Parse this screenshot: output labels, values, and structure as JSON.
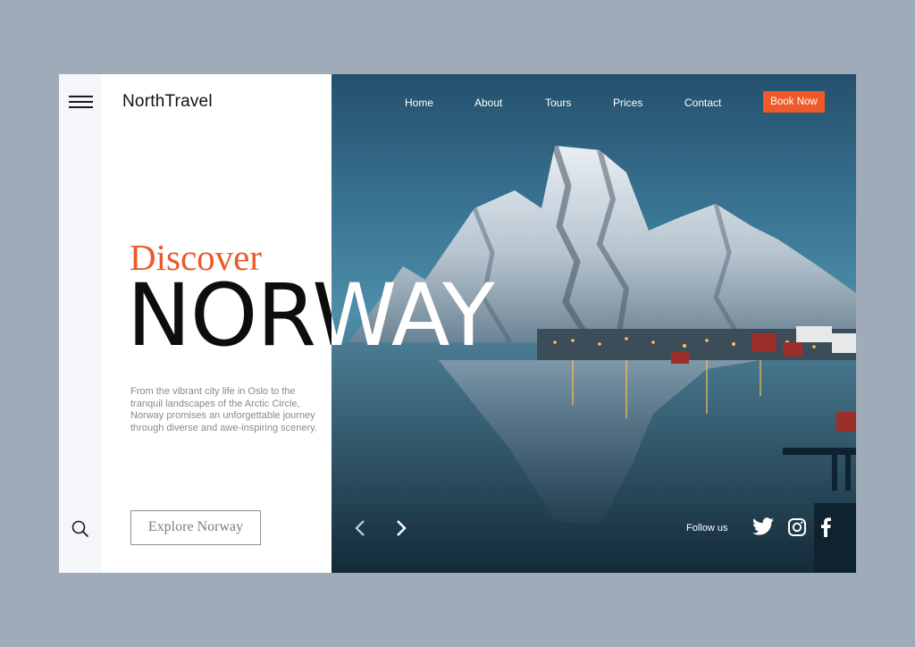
{
  "brand": {
    "name": "NorthTravel"
  },
  "nav": {
    "items": [
      {
        "label": "Home"
      },
      {
        "label": "About"
      },
      {
        "label": "Tours"
      },
      {
        "label": "Prices"
      },
      {
        "label": "Contact"
      }
    ],
    "cta_label": "Book Now"
  },
  "hero": {
    "kicker": "Discover",
    "headline": "NORWAY",
    "description": "From the vibrant city life in Oslo to the tranquil landscapes of the Arctic Circle, Norway promises an unforgettable journey through diverse and awe-inspiring scenery.",
    "cta_label": "Explore Norway",
    "follow_label": "Follow us"
  },
  "icons": {
    "menu": "hamburger-menu-icon",
    "search": "search-icon",
    "prev": "chevron-left-icon",
    "next": "chevron-right-icon",
    "social": [
      "twitter-icon",
      "instagram-icon",
      "facebook-icon"
    ]
  },
  "colors": {
    "accent": "#f05a28",
    "background": "#9fabb8",
    "rail": "#f5f6f9"
  }
}
